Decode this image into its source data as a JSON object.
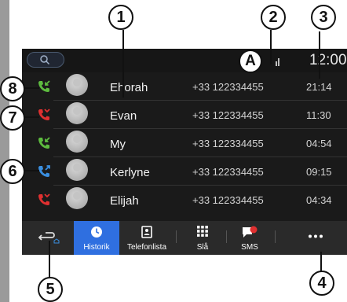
{
  "status": {
    "time": "12:00"
  },
  "calls": [
    {
      "name": "Ehorah",
      "number": "+33 122334455",
      "time": "21:14",
      "type": "incoming",
      "color": "#5dbb3f"
    },
    {
      "name": "Evan",
      "number": "+33 122334455",
      "time": "11:30",
      "type": "missed",
      "color": "#e03030"
    },
    {
      "name": "My",
      "number": "+33 122334455",
      "time": "04:54",
      "type": "incoming",
      "color": "#5dbb3f"
    },
    {
      "name": "Kerlyne",
      "number": "+33 122334455",
      "time": "09:15",
      "type": "outgoing",
      "color": "#3a8fe0"
    },
    {
      "name": "Elijah",
      "number": "+33 122334455",
      "time": "04:34",
      "type": "missed",
      "color": "#e03030"
    }
  ],
  "tabs": [
    {
      "label": "",
      "icon": "back-icon"
    },
    {
      "label": "Historik",
      "icon": "clock-icon",
      "active": true
    },
    {
      "label": "Telefonlista",
      "icon": "contacts-icon"
    },
    {
      "label": "Slå",
      "icon": "keypad-icon"
    },
    {
      "label": "SMS",
      "icon": "sms-icon"
    },
    {
      "label": "",
      "icon": "more-icon"
    }
  ],
  "callouts": {
    "c1": "1",
    "c2": "2",
    "c3": "3",
    "c4": "4",
    "c5": "5",
    "c6": "6",
    "c7": "7",
    "c8": "8",
    "cA": "A"
  },
  "colors": {
    "accent": "#2f6fe0",
    "background": "#1a1a1a",
    "sms_badge": "#e03030"
  }
}
